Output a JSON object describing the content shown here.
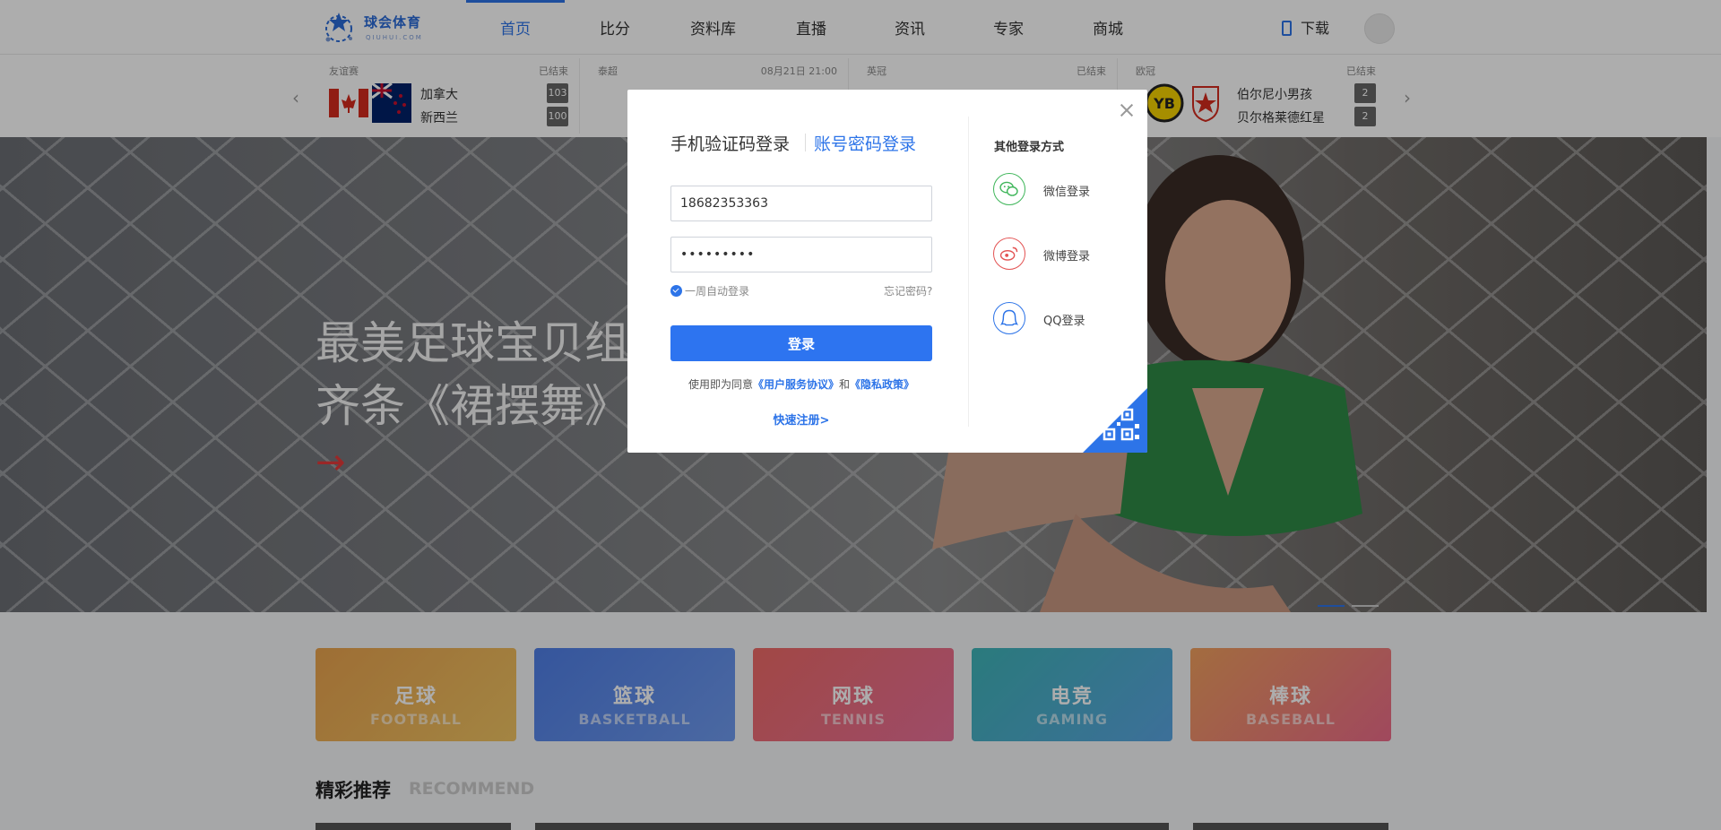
{
  "header": {
    "logo_name": "球会体育",
    "logo_sub": "QIUHUI.COM",
    "nav": [
      "首页",
      "比分",
      "资料库",
      "直播",
      "资讯",
      "专家",
      "商城"
    ],
    "active_index": 0,
    "download_label": "下载"
  },
  "scorebar": {
    "prev_icon": "chevron-left-icon",
    "next_icon": "chevron-right-icon",
    "matches": [
      {
        "league": "友谊赛",
        "status": "已结束",
        "team1": "加拿大",
        "team2": "新西兰",
        "score1": "103",
        "score2": "100"
      },
      {
        "league": "泰超",
        "status": "08月21日 21:00",
        "team1": "",
        "team2": "",
        "score1": "",
        "score2": ""
      },
      {
        "league": "英冠",
        "status": "已结束",
        "team1": "",
        "team2": "",
        "score1": "",
        "score2": ""
      },
      {
        "league": "欧冠",
        "status": "已结束",
        "team1": "伯尔尼小男孩",
        "team2": "贝尔格莱德红星",
        "score1": "2",
        "score2": "2"
      }
    ]
  },
  "banner": {
    "title_line1": "最美足球宝贝组",
    "title_line2": "齐条《裙摆舞》",
    "arrow": "→"
  },
  "categories": [
    {
      "cn": "足球",
      "en": "FOOTBALL",
      "color": "#e8a94e"
    },
    {
      "cn": "篮球",
      "en": "BASKETBALL",
      "color": "#5b86e6"
    },
    {
      "cn": "网球",
      "en": "TENNIS",
      "color": "#e8687a"
    },
    {
      "cn": "电竞",
      "en": "GAMING",
      "color": "#4db3c9"
    },
    {
      "cn": "棒球",
      "en": "BASEBALL",
      "color": "#ee8f7a"
    }
  ],
  "recommend": {
    "title": "精彩推荐",
    "en": "RECOMMEND"
  },
  "modal": {
    "tab_sms": "手机验证码登录",
    "tab_password": "账号密码登录",
    "phone_value": "18682353363",
    "password_value": "•••••••••",
    "remember_label": "一周自动登录",
    "forgot_label": "忘记密码?",
    "login_button": "登录",
    "agree_prefix": "使用即为同意",
    "agree_terms": "《用户服务协议》",
    "agree_and": "和",
    "agree_privacy": "《隐私政策》",
    "quick_register": "快速注册>",
    "other_title": "其他登录方式",
    "socials": [
      {
        "label": "微信登录",
        "icon": "wechat-icon",
        "color": "#3fb65a"
      },
      {
        "label": "微博登录",
        "icon": "weibo-icon",
        "color": "#e35353"
      },
      {
        "label": "QQ登录",
        "icon": "qq-icon",
        "color": "#2d74e8"
      }
    ]
  },
  "colors": {
    "accent": "#2d74e8",
    "banner_arrow": "#e23a3a"
  }
}
